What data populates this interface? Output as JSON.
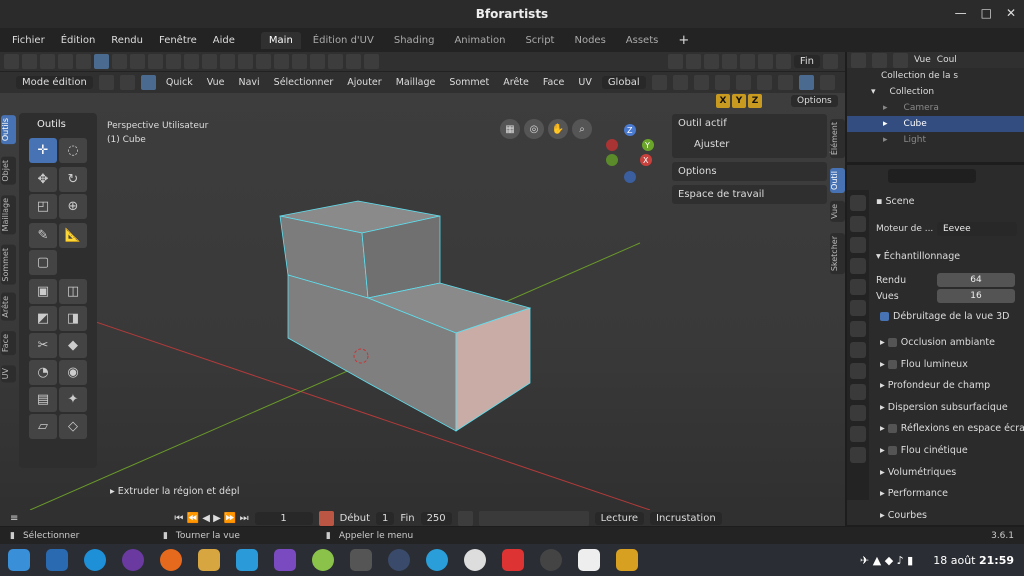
{
  "window": {
    "title": "Bforartists"
  },
  "menu": {
    "items": [
      "Fichier",
      "Édition",
      "Rendu",
      "Fenêtre",
      "Aide"
    ]
  },
  "workspaces": [
    "Main",
    "Édition d'UV",
    "Shading",
    "Animation",
    "Script",
    "Nodes",
    "Assets",
    "+"
  ],
  "toolbar1": {
    "fin_label": "Fin"
  },
  "header": {
    "mode": "Mode édition",
    "items": [
      "Quick",
      "Vue",
      "Navi",
      "Sélectionner",
      "Ajouter",
      "Maillage",
      "Sommet",
      "Arête",
      "Face",
      "UV"
    ],
    "orientation": "Global"
  },
  "axis_buttons": [
    "X",
    "Y",
    "Z"
  ],
  "options_button": "Options",
  "viewport": {
    "perspective": "Perspective Utilisateur",
    "object": "(1) Cube",
    "last_op": "Extruder la région et dépl"
  },
  "left_tabs": [
    "Outils",
    "Objet",
    "Maillage",
    "Sommet",
    "Arête",
    "Face",
    "UV"
  ],
  "tools_panel": {
    "title": "Outils"
  },
  "right_tabs": [
    "Élément",
    "Outil",
    "Vue",
    "Sketcher"
  ],
  "npanel": {
    "active_tool": "Outil actif",
    "tool_name": "Ajuster",
    "options": "Options",
    "workspace": "Espace de travail"
  },
  "outliner": {
    "menu_vue": "Vue",
    "menu_coul": "Coul",
    "scene_collection": "Collection de la s",
    "rows": [
      {
        "label": "Collection"
      },
      {
        "label": "Camera"
      },
      {
        "label": "Cube"
      },
      {
        "label": "Light"
      }
    ]
  },
  "properties": {
    "scene": "Scene",
    "engine_label": "Moteur de ...",
    "engine": "Eevee",
    "section": "Échantillonnage",
    "render_label": "Rendu",
    "render_value": "64",
    "views_label": "Vues",
    "views_value": "16",
    "denoise": "Débruitage de la vue 3D",
    "sections": [
      "Occlusion ambiante",
      "Flou lumineux",
      "Profondeur de champ",
      "Dispersion subsurfacique",
      "Réflexions en espace écra",
      "Flou cinétique",
      "Volumétriques",
      "Performance",
      "Courbes"
    ]
  },
  "timeline": {
    "frame": "1",
    "start_label": "Début",
    "start": "1",
    "end_label": "Fin",
    "end": "250",
    "playback": "Lecture",
    "keying": "Incrustation"
  },
  "status": {
    "select": "Sélectionner",
    "rotate": "Tourner la vue",
    "menu": "Appeler le menu",
    "version": "3.6.1"
  },
  "taskbar": {
    "date": "18 août",
    "time": "21:59"
  },
  "colors": {
    "accent": "#4772b3",
    "selected_edge": "#5ee0f0",
    "x_axis": "#b33a3a",
    "y_axis": "#6a9a2a"
  }
}
